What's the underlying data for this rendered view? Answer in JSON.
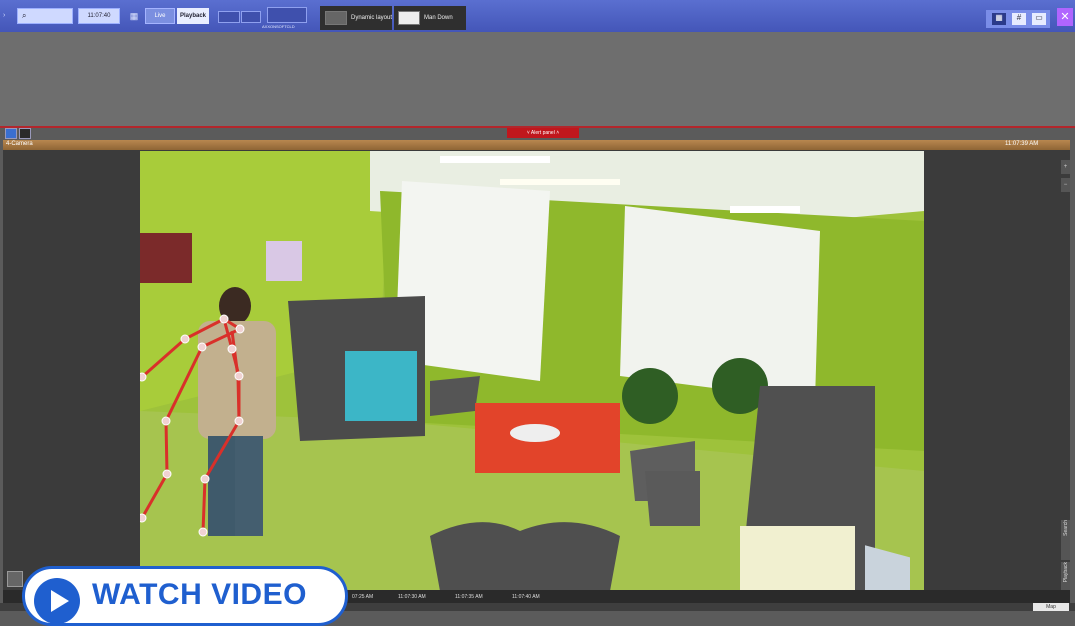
{
  "toolbar": {
    "clock": "11:07:40",
    "live_label": "Live",
    "playback_label": "Playback",
    "layout_name": "AXXONSOFTCLD",
    "tabs": [
      {
        "label": "Dynamic layout"
      },
      {
        "label": "Man Down"
      }
    ]
  },
  "alert_panel": {
    "label": "Alert panel"
  },
  "camera": {
    "title": "4-Camera",
    "timestamp": "11:07:39 AM"
  },
  "side_tabs": {
    "search": "Search",
    "playback": "Playback"
  },
  "timeline": {
    "ticks": [
      "07:25 AM",
      "11:07:30 AM",
      "11:07:35 AM",
      "11:07:40 AM"
    ]
  },
  "bottom": {
    "map_label": "Map"
  },
  "overlay": {
    "watch_video": "WATCH VIDEO"
  },
  "colors": {
    "toolbar_blue": "#4d62c4",
    "alert_red": "#c0171d",
    "camera_title": "#a77543",
    "skeleton": "#d9302a",
    "watch_blue": "#1f5fcf"
  },
  "icons": [
    "search-icon",
    "layout-grid-icon",
    "camera-thumb-icon",
    "tools-icon",
    "zoom-plus-icon",
    "zoom-minus-icon",
    "export-icon",
    "play-icon"
  ]
}
